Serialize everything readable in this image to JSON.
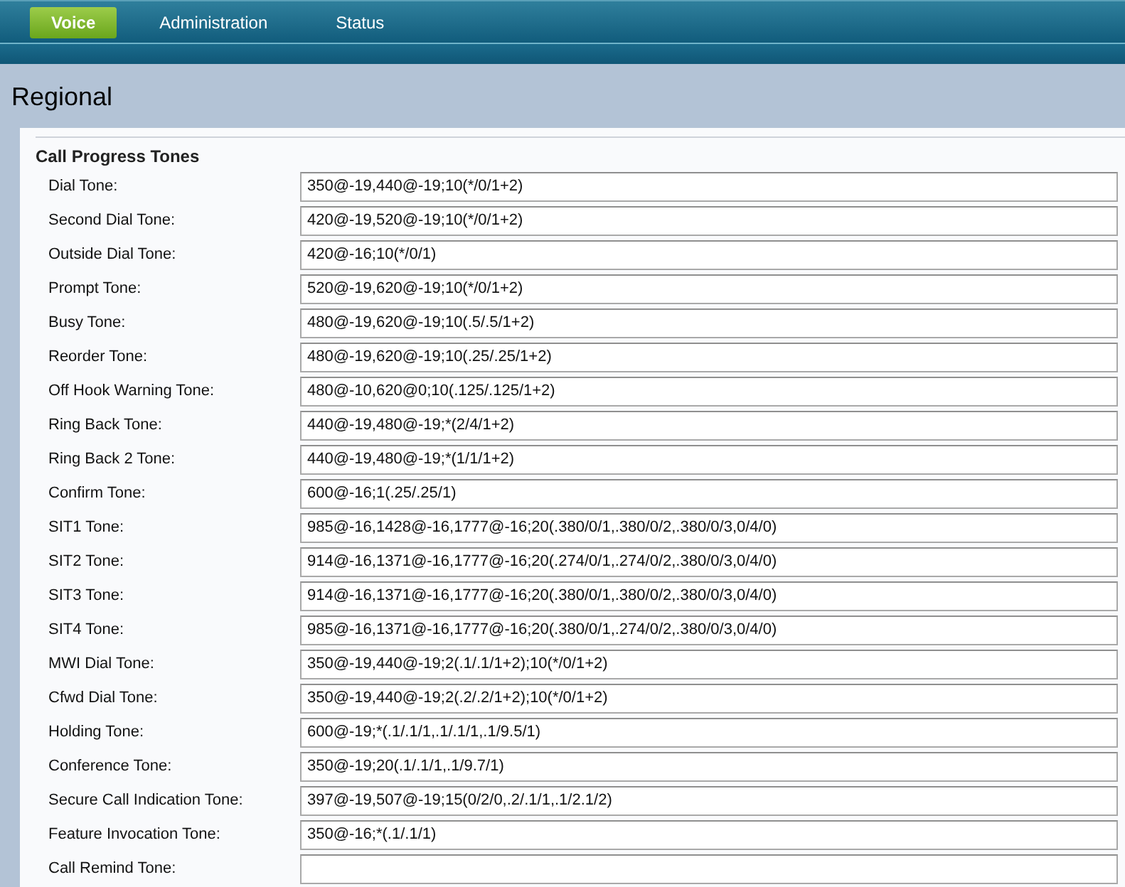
{
  "nav": {
    "tabs": [
      {
        "label": "Voice",
        "selected": true
      },
      {
        "label": "Administration",
        "selected": false
      },
      {
        "label": "Status",
        "selected": false
      }
    ]
  },
  "page_title": "Regional",
  "section": {
    "title": "Call Progress Tones",
    "fields": [
      {
        "label": "Dial Tone:",
        "value": "350@-19,440@-19;10(*/0/1+2)"
      },
      {
        "label": "Second Dial Tone:",
        "value": "420@-19,520@-19;10(*/0/1+2)"
      },
      {
        "label": "Outside Dial Tone:",
        "value": "420@-16;10(*/0/1)"
      },
      {
        "label": "Prompt Tone:",
        "value": "520@-19,620@-19;10(*/0/1+2)"
      },
      {
        "label": "Busy Tone:",
        "value": "480@-19,620@-19;10(.5/.5/1+2)"
      },
      {
        "label": "Reorder Tone:",
        "value": "480@-19,620@-19;10(.25/.25/1+2)"
      },
      {
        "label": "Off Hook Warning Tone:",
        "value": "480@-10,620@0;10(.125/.125/1+2)"
      },
      {
        "label": "Ring Back Tone:",
        "value": "440@-19,480@-19;*(2/4/1+2)"
      },
      {
        "label": "Ring Back 2 Tone:",
        "value": "440@-19,480@-19;*(1/1/1+2)"
      },
      {
        "label": "Confirm Tone:",
        "value": "600@-16;1(.25/.25/1)"
      },
      {
        "label": "SIT1 Tone:",
        "value": "985@-16,1428@-16,1777@-16;20(.380/0/1,.380/0/2,.380/0/3,0/4/0)"
      },
      {
        "label": "SIT2 Tone:",
        "value": "914@-16,1371@-16,1777@-16;20(.274/0/1,.274/0/2,.380/0/3,0/4/0)"
      },
      {
        "label": "SIT3 Tone:",
        "value": "914@-16,1371@-16,1777@-16;20(.380/0/1,.380/0/2,.380/0/3,0/4/0)"
      },
      {
        "label": "SIT4 Tone:",
        "value": "985@-16,1371@-16,1777@-16;20(.380/0/1,.274/0/2,.380/0/3,0/4/0)"
      },
      {
        "label": "MWI Dial Tone:",
        "value": "350@-19,440@-19;2(.1/.1/1+2);10(*/0/1+2)"
      },
      {
        "label": "Cfwd Dial Tone:",
        "value": "350@-19,440@-19;2(.2/.2/1+2);10(*/0/1+2)"
      },
      {
        "label": "Holding Tone:",
        "value": "600@-19;*(.1/.1/1,.1/.1/1,.1/9.5/1)"
      },
      {
        "label": "Conference Tone:",
        "value": "350@-19;20(.1/.1/1,.1/9.7/1)"
      },
      {
        "label": "Secure Call Indication Tone:",
        "value": "397@-19,507@-19;15(0/2/0,.2/.1/1,.1/2.1/2)"
      },
      {
        "label": "Feature Invocation Tone:",
        "value": "350@-16;*(.1/.1/1)"
      },
      {
        "label": "Call Remind Tone:"
      }
    ]
  }
}
